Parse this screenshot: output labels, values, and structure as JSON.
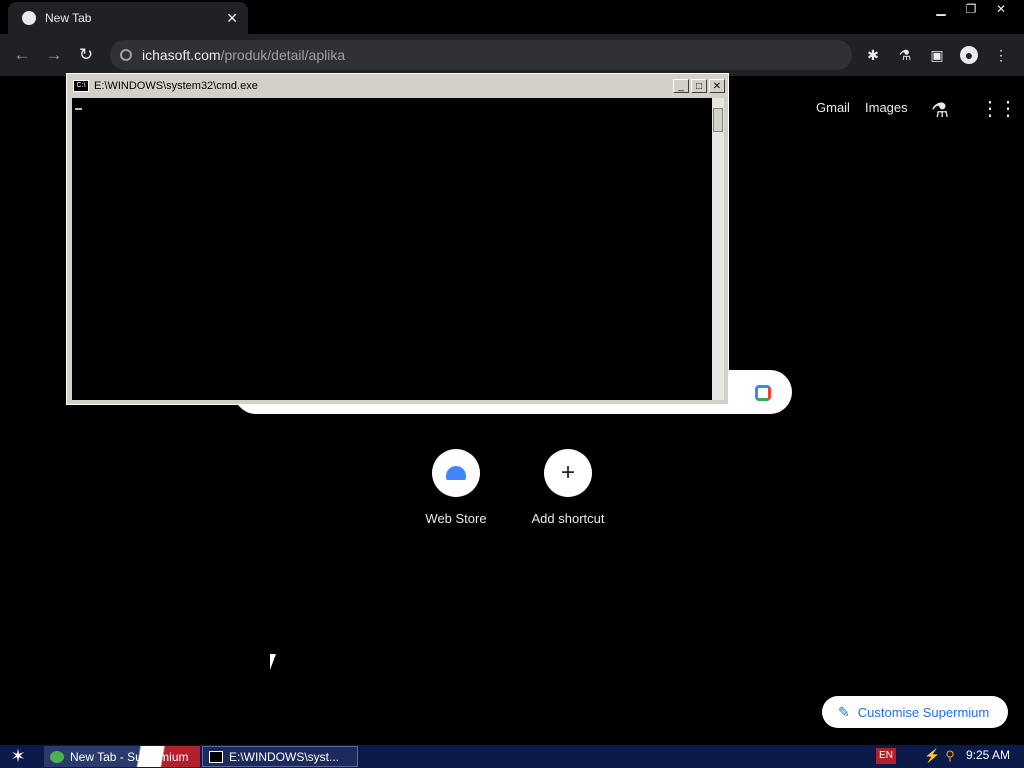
{
  "browser": {
    "tab_title": "New Tab",
    "url_domain": "ichasoft.com",
    "url_path": "/produk/detail/aplika"
  },
  "ntp": {
    "gmail": "Gmail",
    "images": "Images",
    "shortcuts": [
      {
        "label": "Web Store"
      },
      {
        "label": "Add shortcut"
      }
    ],
    "customise_label": "Customise Supermium"
  },
  "cmd": {
    "title": "E:\\WINDOWS\\system32\\cmd.exe"
  },
  "taskbar": {
    "task1_label": "New Tab - Supermium",
    "task2_label": "E:\\WINDOWS\\syst...",
    "lang": "EN",
    "clock": "9:25 AM"
  }
}
